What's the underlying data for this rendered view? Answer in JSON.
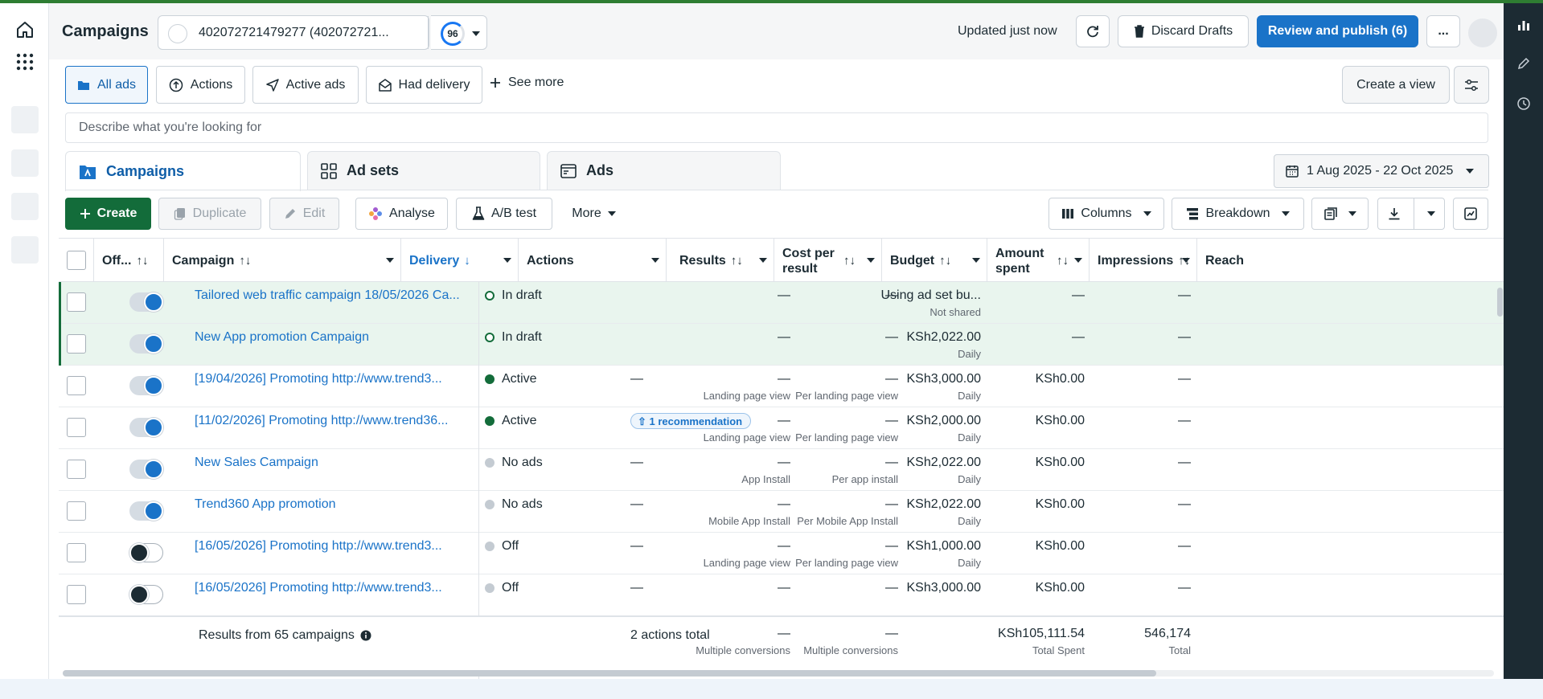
{
  "header": {
    "title": "Campaigns",
    "account": "402072721479277 (402072721...",
    "score": "96",
    "updated": "Updated just now",
    "discard_label": "Discard Drafts",
    "publish_label": "Review and publish (6)",
    "more_label": "..."
  },
  "views": {
    "chips": [
      "All ads",
      "Actions",
      "Active ads",
      "Had delivery"
    ],
    "see_more": "See more",
    "create_view": "Create a view"
  },
  "search": {
    "placeholder": "Describe what you're looking for"
  },
  "tabs": [
    "Campaigns",
    "Ad sets",
    "Ads"
  ],
  "date_range": "1 Aug 2025 - 22 Oct 2025",
  "toolbar": {
    "create": "Create",
    "duplicate": "Duplicate",
    "edit": "Edit",
    "analyse": "Analyse",
    "ab_test": "A/B test",
    "more": "More",
    "columns": "Columns",
    "breakdown": "Breakdown"
  },
  "columns": {
    "off": "Off...",
    "campaign": "Campaign",
    "delivery": "Delivery",
    "actions": "Actions",
    "results": "Results",
    "cost_per_result_1": "Cost per",
    "cost_per_result_2": "result",
    "budget": "Budget",
    "amount_spent_1": "Amount",
    "amount_spent_2": "spent",
    "impressions": "Impressions",
    "reach": "Reach"
  },
  "rows": [
    {
      "on": true,
      "name": "Tailored web traffic campaign 18/05/2026 Ca...",
      "delivery": "In draft",
      "dot": "draft",
      "actions": "",
      "results": "—",
      "results_sub": "",
      "cpr": "—",
      "cpr_sub": "",
      "budget": "Using ad set bu...",
      "budget_sub": "Not shared",
      "spent": "—",
      "impressions": "—",
      "draft": true
    },
    {
      "on": true,
      "name": "New App promotion Campaign",
      "delivery": "In draft",
      "dot": "draft",
      "actions": "",
      "results": "—",
      "results_sub": "",
      "cpr": "—",
      "cpr_sub": "",
      "budget": "KSh2,022.00",
      "budget_sub": "Daily",
      "spent": "—",
      "impressions": "—",
      "draft": true
    },
    {
      "on": true,
      "name": "[19/04/2026] Promoting http://www.trend3...",
      "delivery": "Active",
      "dot": "active",
      "actions": "—",
      "results": "—",
      "results_sub": "Landing page view",
      "cpr": "—",
      "cpr_sub": "Per landing page view",
      "budget": "KSh3,000.00",
      "budget_sub": "Daily",
      "spent": "KSh0.00",
      "impressions": "—",
      "draft": false
    },
    {
      "on": true,
      "name": "[11/02/2026] Promoting http://www.trend36...",
      "delivery": "Active",
      "dot": "active",
      "actions": "",
      "recommendation": "1 recommendation",
      "results": "—",
      "results_sub": "Landing page view",
      "cpr": "—",
      "cpr_sub": "Per landing page view",
      "budget": "KSh2,000.00",
      "budget_sub": "Daily",
      "spent": "KSh0.00",
      "impressions": "—",
      "draft": false
    },
    {
      "on": true,
      "name": "New Sales Campaign",
      "delivery": "No ads",
      "dot": "grey",
      "actions": "—",
      "results": "—",
      "results_sub": "App Install",
      "cpr": "—",
      "cpr_sub": "Per app install",
      "budget": "KSh2,022.00",
      "budget_sub": "Daily",
      "spent": "KSh0.00",
      "impressions": "—",
      "draft": false
    },
    {
      "on": true,
      "name": "Trend360 App promotion",
      "delivery": "No ads",
      "dot": "grey",
      "actions": "—",
      "results": "—",
      "results_sub": "Mobile App Install",
      "cpr": "—",
      "cpr_sub": "Per Mobile App Install",
      "budget": "KSh2,022.00",
      "budget_sub": "Daily",
      "spent": "KSh0.00",
      "impressions": "—",
      "draft": false
    },
    {
      "on": false,
      "name": "[16/05/2026] Promoting http://www.trend3...",
      "delivery": "Off",
      "dot": "grey",
      "actions": "—",
      "results": "—",
      "results_sub": "Landing page view",
      "cpr": "—",
      "cpr_sub": "Per landing page view",
      "budget": "KSh1,000.00",
      "budget_sub": "Daily",
      "spent": "KSh0.00",
      "impressions": "—",
      "draft": false
    },
    {
      "on": false,
      "name": "[16/05/2026] Promoting http://www.trend3...",
      "delivery": "Off",
      "dot": "grey",
      "actions": "—",
      "results": "—",
      "results_sub": "",
      "cpr": "—",
      "cpr_sub": "",
      "budget": "KSh3,000.00",
      "budget_sub": "",
      "spent": "KSh0.00",
      "impressions": "—",
      "draft": false
    }
  ],
  "footer": {
    "label": "Results from 65 campaigns",
    "actions": "2 actions total",
    "results": "—",
    "results_sub": "Multiple conversions",
    "cpr": "—",
    "cpr_sub": "Multiple conversions",
    "spent": "KSh105,111.54",
    "spent_sub": "Total Spent",
    "impressions": "546,174",
    "impressions_sub": "Total"
  },
  "colors": {
    "primary": "#1a73c8",
    "create": "#136c3a",
    "draft_row": "#e9f5ee",
    "sidebar_dark": "#1c2b33"
  }
}
